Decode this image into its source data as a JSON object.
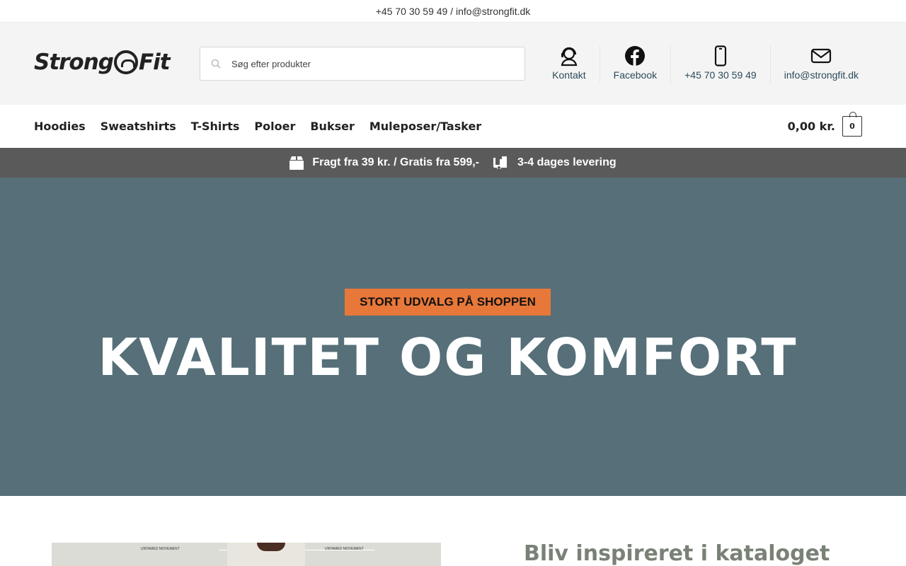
{
  "topbar": {
    "contact": "+45 70 30 59 49 / info@strongfit.dk"
  },
  "header": {
    "logo_left": "Strong",
    "logo_right": "Fit",
    "search_placeholder": "Søg efter produkter",
    "links": [
      {
        "label": "Kontakt",
        "icon": "headset-icon"
      },
      {
        "label": "Facebook",
        "icon": "facebook-icon"
      },
      {
        "label": "+45 70 30 59 49",
        "icon": "phone-icon"
      },
      {
        "label": "info@strongfit.dk",
        "icon": "envelope-icon"
      }
    ]
  },
  "nav": {
    "items": [
      "Hoodies",
      "Sweatshirts",
      "T-Shirts",
      "Poloer",
      "Bukser",
      "Muleposer/Tasker"
    ],
    "cart_total": "0,00 kr.",
    "cart_count": "0"
  },
  "shipbar": {
    "shipping": "Fragt fra 39 kr. / Gratis fra 599,-",
    "delivery": "3-4 dages levering"
  },
  "hero": {
    "badge": "STORT UDVALG PÅ SHOPPEN",
    "title": "KVALITET OG KOMFORT"
  },
  "catalog": {
    "title": "Bliv inspireret i kataloget",
    "image_tags": [
      "UNTAMED MOVEMENT",
      "UNTAMED MOVEMENT"
    ]
  },
  "colors": {
    "hero_bg": "#566f79",
    "badge_bg": "#e8783a",
    "shipbar_bg": "#5a5a5a",
    "link_color": "#2c4a5a",
    "catalog_title": "#7a8176"
  }
}
